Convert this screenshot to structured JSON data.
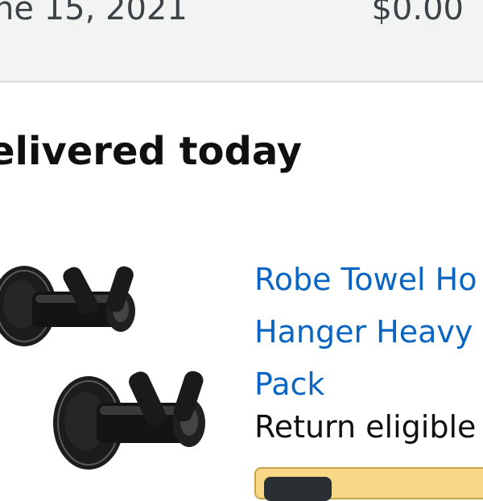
{
  "order_summary": {
    "date_fragment": "ne 15, 2021",
    "total": "$0.00"
  },
  "delivery": {
    "status_fragment": "elivered today"
  },
  "product": {
    "image_icon": "robe-towel-hooks-icon",
    "title_lines": [
      "Robe Towel Ho",
      "Hanger Heavy",
      "Pack"
    ],
    "return_info": "Return eligible t"
  },
  "colors": {
    "link": "#0a66c2",
    "button": "#f8d887",
    "summary_bg": "#f2f3f3"
  }
}
